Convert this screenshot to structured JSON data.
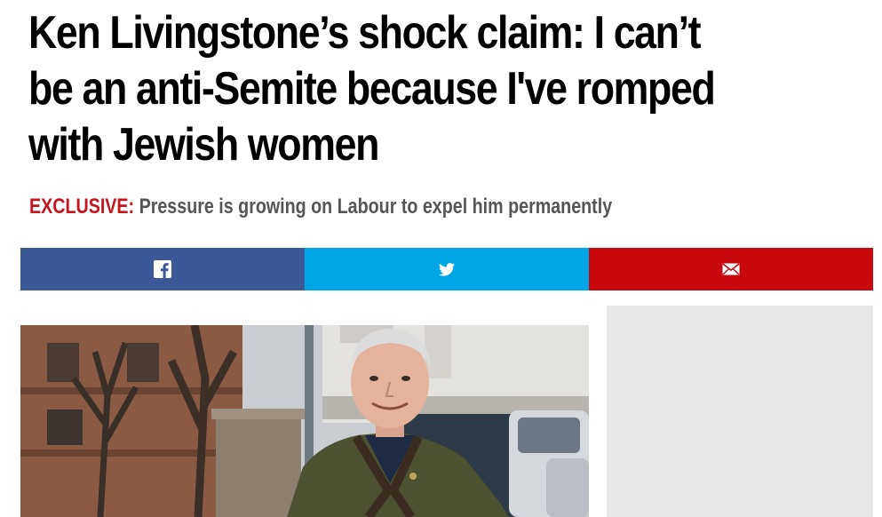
{
  "article": {
    "headline_lines": [
      "Ken Livingstone’s shock claim: I can’t",
      "be an anti-Semite because I've romped",
      "with Jewish women"
    ],
    "standfirst_tag": "EXCLUSIVE:",
    "standfirst_text": " Pressure is growing on Labour to expel him permanently"
  },
  "share": {
    "facebook_icon": "facebook-icon",
    "twitter_icon": "twitter-icon",
    "email_icon": "email-icon",
    "facebook_color": "#3b5998",
    "twitter_color": "#00a6e6",
    "email_color": "#c8070e"
  },
  "colors": {
    "standfirst_tag": "#c4161c",
    "standfirst_text": "#555555",
    "ad_background": "#e7e7e7"
  }
}
